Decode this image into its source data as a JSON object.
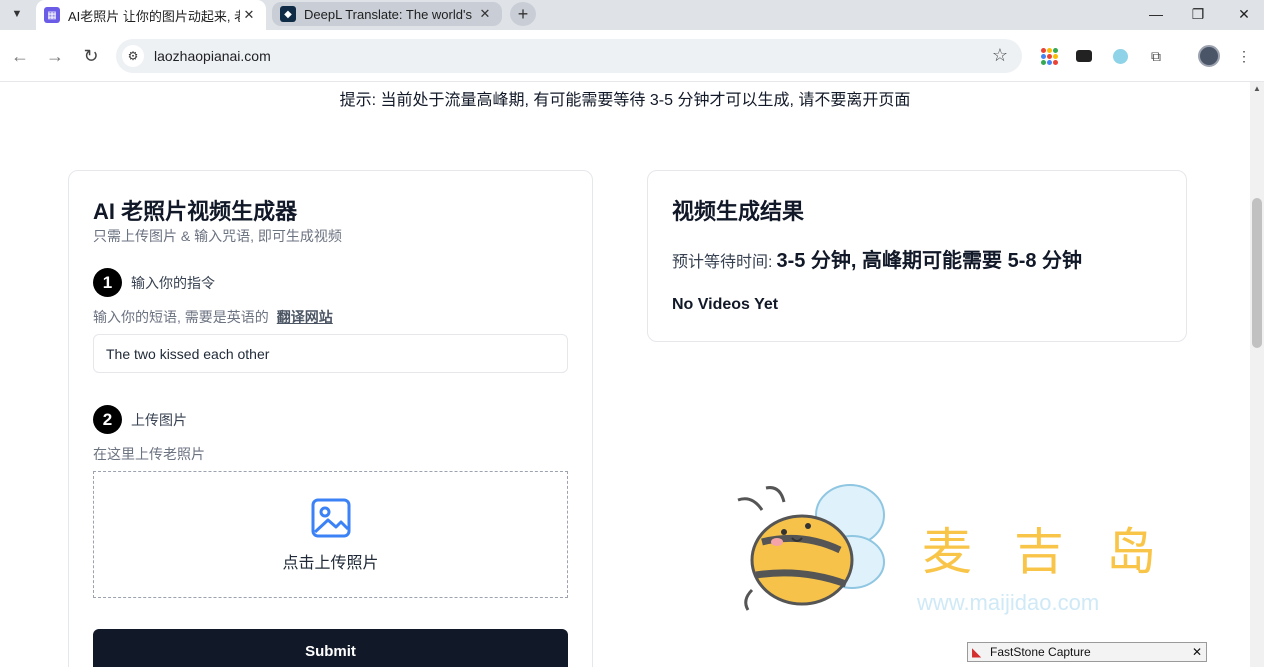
{
  "browser": {
    "tabs": [
      {
        "title": "AI老照片 让你的图片动起来, 老",
        "favicon": "photo-app-icon",
        "close": "✕"
      },
      {
        "title": "DeepL Translate: The world's",
        "favicon": "deepl-icon",
        "close": "✕"
      }
    ],
    "new_tab": "+",
    "url": "laozhaopianai.com"
  },
  "page": {
    "notice": "提示: 当前处于流量高峰期, 有可能需要等待 3-5 分钟才可以生成, 请不要离开页面",
    "generator": {
      "title": "AI 老照片视频生成器",
      "subtitle": "只需上传图片 & 输入咒语, 即可生成视频",
      "step1": {
        "number": "1",
        "label": "输入你的指令"
      },
      "hint1": "输入你的短语, 需要是英语的",
      "translate_link": "翻译网站",
      "prompt_value": "The two kissed each other",
      "step2": {
        "number": "2",
        "label": "上传图片"
      },
      "hint2": "在这里上传老照片",
      "upload_label": "点击上传照片",
      "submit": "Submit"
    },
    "result": {
      "title": "视频生成结果",
      "wait_prefix": "预计等待时间:",
      "wait_value": "3-5 分钟, 高峰期可能需要 5-8 分钟",
      "empty": "No Videos Yet"
    }
  },
  "watermark": {
    "title": "麦吉岛",
    "url": "www.maijidao.com"
  },
  "faststone": {
    "title": "FastStone Capture",
    "close": "✕"
  },
  "colors": {
    "accent": "#111827",
    "watermark_yellow": "#f9c548",
    "upload_icon": "#3b82f6"
  }
}
